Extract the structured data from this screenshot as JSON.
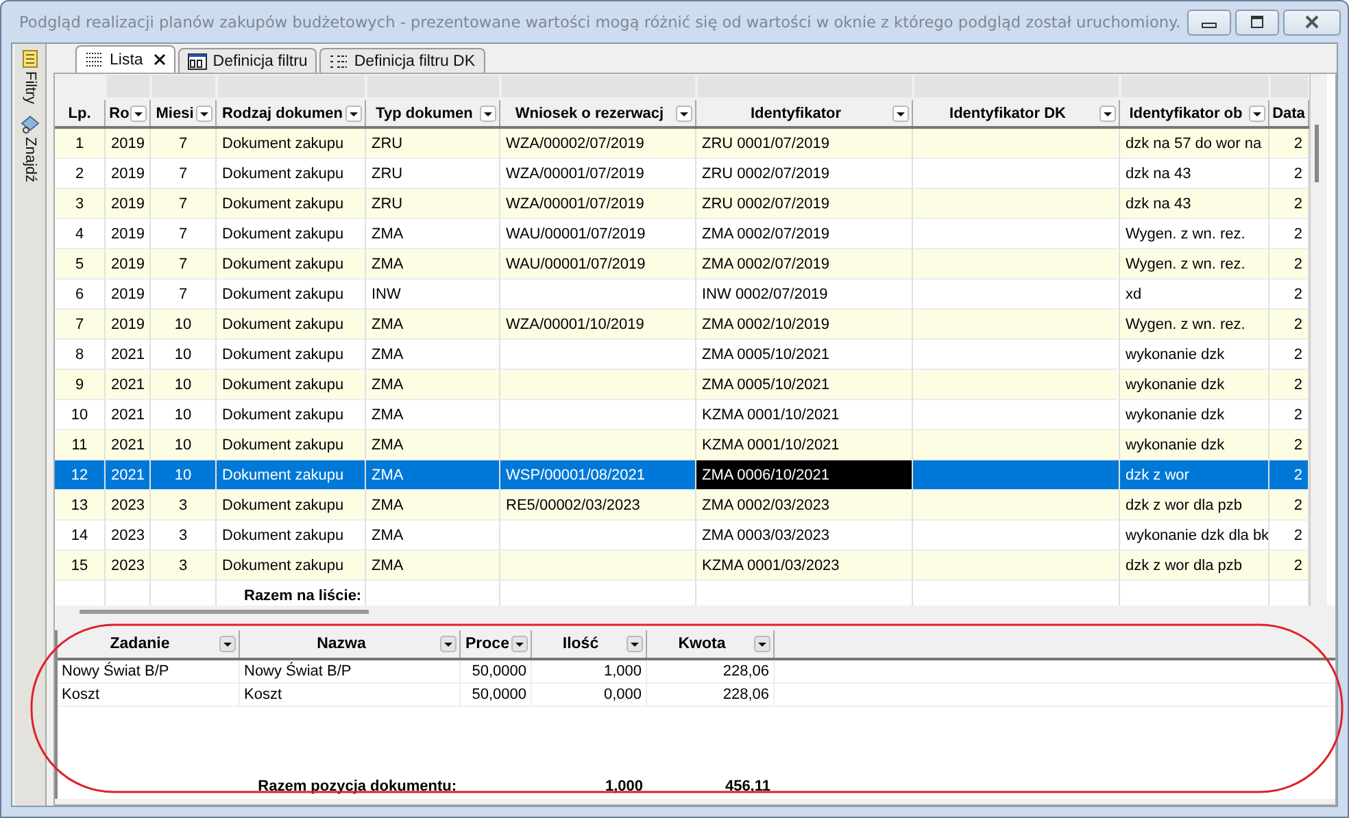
{
  "window": {
    "title": "Podgląd realizacji planów zakupów budżetowych - prezentowane wartości mogą różnić się od wartości w oknie z którego podgląd został uruchomiony."
  },
  "side_panel": [
    {
      "label": "Filtry",
      "kind": "notes"
    },
    {
      "label": "Znajdź",
      "kind": "find"
    }
  ],
  "tabs": [
    {
      "label": "Lista",
      "kind": "list",
      "selected": true,
      "closable": true
    },
    {
      "label": "Definicja filtru",
      "kind": "form",
      "selected": false,
      "closable": false
    },
    {
      "label": "Definicja filtru DK",
      "kind": "tree",
      "selected": false,
      "closable": false
    }
  ],
  "table": {
    "columns": [
      {
        "label": "Lp.",
        "kind": "number",
        "dropdown": false,
        "cursor": false
      },
      {
        "label": "Ro",
        "kind": "text",
        "dropdown": true,
        "cursor": false
      },
      {
        "label": "Miesi",
        "kind": "number",
        "dropdown": true,
        "cursor": false
      },
      {
        "label": "Rodzaj dokumen",
        "kind": "text",
        "dropdown": true,
        "cursor": false
      },
      {
        "label": "Typ dokumen",
        "kind": "text",
        "dropdown": true,
        "cursor": false
      },
      {
        "label": "Wniosek o rezerwacj",
        "kind": "text",
        "dropdown": true,
        "cursor": false
      },
      {
        "label": "Identyfikator",
        "kind": "text",
        "dropdown": true,
        "cursor": true
      },
      {
        "label": "Identyfikator DK",
        "kind": "text",
        "dropdown": true,
        "cursor": false
      },
      {
        "label": "Identyfikator ob",
        "kind": "text",
        "dropdown": true,
        "cursor": false
      },
      {
        "label": "Data",
        "kind": "date",
        "dropdown": false,
        "cursor": false
      }
    ],
    "rows": [
      {
        "selected": false,
        "cells": [
          "1",
          "2019",
          "7",
          "Dokument zakupu",
          "ZRU",
          "WZA/00002/07/2019",
          "ZRU 0001/07/2019",
          "",
          "dzk na 57 do wor na",
          "2"
        ]
      },
      {
        "selected": false,
        "cells": [
          "2",
          "2019",
          "7",
          "Dokument zakupu",
          "ZRU",
          "WZA/00001/07/2019",
          "ZRU 0002/07/2019",
          "",
          "dzk na 43",
          "2"
        ]
      },
      {
        "selected": false,
        "cells": [
          "3",
          "2019",
          "7",
          "Dokument zakupu",
          "ZRU",
          "WZA/00001/07/2019",
          "ZRU 0002/07/2019",
          "",
          "dzk na 43",
          "2"
        ]
      },
      {
        "selected": false,
        "cells": [
          "4",
          "2019",
          "7",
          "Dokument zakupu",
          "ZMA",
          "WAU/00001/07/2019",
          "ZMA 0002/07/2019",
          "",
          "Wygen. z wn. rez.",
          "2"
        ]
      },
      {
        "selected": false,
        "cells": [
          "5",
          "2019",
          "7",
          "Dokument zakupu",
          "ZMA",
          "WAU/00001/07/2019",
          "ZMA 0002/07/2019",
          "",
          "Wygen. z wn. rez.",
          "2"
        ]
      },
      {
        "selected": false,
        "cells": [
          "6",
          "2019",
          "7",
          "Dokument zakupu",
          "INW",
          "",
          "INW 0002/07/2019",
          "",
          "xd",
          "2"
        ]
      },
      {
        "selected": false,
        "cells": [
          "7",
          "2019",
          "10",
          "Dokument zakupu",
          "ZMA",
          "WZA/00001/10/2019",
          "ZMA 0002/10/2019",
          "",
          "Wygen. z wn. rez.",
          "2"
        ]
      },
      {
        "selected": false,
        "cells": [
          "8",
          "2021",
          "10",
          "Dokument zakupu",
          "ZMA",
          "",
          "ZMA 0005/10/2021",
          "",
          "wykonanie dzk",
          "2"
        ]
      },
      {
        "selected": false,
        "cells": [
          "9",
          "2021",
          "10",
          "Dokument zakupu",
          "ZMA",
          "",
          "ZMA 0005/10/2021",
          "",
          "wykonanie dzk",
          "2"
        ]
      },
      {
        "selected": false,
        "cells": [
          "10",
          "2021",
          "10",
          "Dokument zakupu",
          "ZMA",
          "",
          "KZMA 0001/10/2021",
          "",
          "wykonanie dzk",
          "2"
        ]
      },
      {
        "selected": false,
        "cells": [
          "11",
          "2021",
          "10",
          "Dokument zakupu",
          "ZMA",
          "",
          "KZMA 0001/10/2021",
          "",
          "wykonanie dzk",
          "2"
        ]
      },
      {
        "selected": true,
        "cells": [
          "12",
          "2021",
          "10",
          "Dokument zakupu",
          "ZMA",
          "WSP/00001/08/2021",
          "ZMA 0006/10/2021",
          "",
          "dzk z wor",
          "2"
        ]
      },
      {
        "selected": false,
        "cells": [
          "13",
          "2023",
          "3",
          "Dokument zakupu",
          "ZMA",
          "RE5/00002/03/2023",
          "ZMA 0002/03/2023",
          "",
          "dzk z wor dla pzb",
          "2"
        ]
      },
      {
        "selected": false,
        "cells": [
          "14",
          "2023",
          "3",
          "Dokument zakupu",
          "ZMA",
          "",
          "ZMA 0003/03/2023",
          "",
          "wykonanie dzk dla bk",
          "2"
        ]
      },
      {
        "selected": false,
        "cells": [
          "15",
          "2023",
          "3",
          "Dokument zakupu",
          "ZMA",
          "",
          "KZMA 0001/03/2023",
          "",
          "dzk z wor dla pzb",
          "2"
        ]
      }
    ],
    "total_label": "Razem na liście:"
  },
  "detail_table": {
    "columns": [
      {
        "label": "Zadanie",
        "kind": "text"
      },
      {
        "label": "Nazwa",
        "kind": "text"
      },
      {
        "label": "Proce",
        "kind": "number"
      },
      {
        "label": "Ilość",
        "kind": "number"
      },
      {
        "label": "Kwota",
        "kind": "number"
      }
    ],
    "rows": [
      [
        "Nowy Świat B/P",
        "Nowy Świat B/P",
        "50,0000",
        "1,000",
        "228,06"
      ],
      [
        "Koszt",
        "Koszt",
        "50,0000",
        "0,000",
        "228,06"
      ]
    ],
    "total_label": "Razem pozycja dokumentu:",
    "total_quantity": "1,000",
    "total_amount": "456,11"
  }
}
